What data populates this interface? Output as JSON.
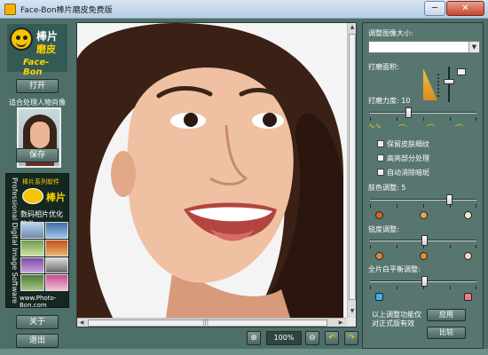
{
  "window": {
    "title": "Face-Bon棒片磨皮免费版",
    "min_label": "─",
    "close_label": "✕"
  },
  "left": {
    "logo": {
      "line1": "棒片",
      "line2": "磨皮",
      "line3": "Face-Bon"
    },
    "open_label": "打开",
    "suitable_label": "适合处理人物肖像",
    "save_label": "保存",
    "series": {
      "vertical_text": "Professional Digital Image Software",
      "brand": "棒片系列软件",
      "badge_text": "Photo-Bon",
      "brand_name": "棒片",
      "subtitle": "数码相片优化软件",
      "url": "www.Photo-Bon.com"
    },
    "about_label": "关于",
    "exit_label": "退出"
  },
  "toolbar": {
    "zoom_in_icon": "zoom-in",
    "zoom": "100%",
    "zoom_out_icon": "zoom-out",
    "rotate_left_icon": "rotate-left",
    "rotate_right_icon": "rotate-right",
    "scroll_grip": "|||"
  },
  "panel": {
    "resize_label": "调整图像大小:",
    "area_label": "打磨面积:",
    "strength_label": "打磨力度: 10",
    "strength_value": 10,
    "opt_texture": "保留皮肤细纹",
    "opt_highlight": "高亮部分处理",
    "opt_freckle": "自动消除暗斑",
    "skin_label": "肤色调整: 5",
    "skin_value": 5,
    "sharp_label": "锐度调整:",
    "wb_label": "全片白平衡调整:",
    "note": "以上调整功能仅对正式版有效",
    "apply_label": "应用",
    "compare_label": "比较"
  },
  "colors": {
    "frame": "#4e6e68",
    "panel": "#577670",
    "accent": "#ffd200"
  }
}
